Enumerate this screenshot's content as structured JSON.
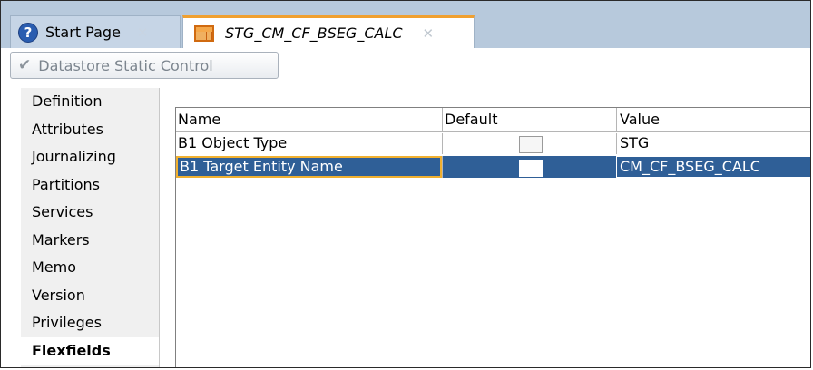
{
  "tabs": [
    {
      "label": "Start Page",
      "icon": "help-icon",
      "active": false
    },
    {
      "label": "STG_CM_CF_BSEG_CALC",
      "icon": "table-icon",
      "active": true
    }
  ],
  "toolbar": {
    "datastore_button_label": "Datastore Static Control"
  },
  "sidebar": {
    "items": [
      {
        "label": "Definition"
      },
      {
        "label": "Attributes"
      },
      {
        "label": "Journalizing"
      },
      {
        "label": "Partitions"
      },
      {
        "label": "Services"
      },
      {
        "label": "Markers"
      },
      {
        "label": "Memo"
      },
      {
        "label": "Version"
      },
      {
        "label": "Privileges"
      },
      {
        "label": "Flexfields",
        "selected": true
      }
    ]
  },
  "grid": {
    "columns": [
      "Name",
      "Default",
      "Value"
    ],
    "rows": [
      {
        "name": "B1 Object Type",
        "default": false,
        "value": "STG"
      },
      {
        "name": "B1 Target Entity Name",
        "default": false,
        "value": "CM_CF_BSEG_CALC",
        "selected": true
      }
    ]
  },
  "colors": {
    "tabstrip": "#b7c9dc",
    "active_tab_accent": "#f0a030",
    "selection": "#2f5f97"
  }
}
